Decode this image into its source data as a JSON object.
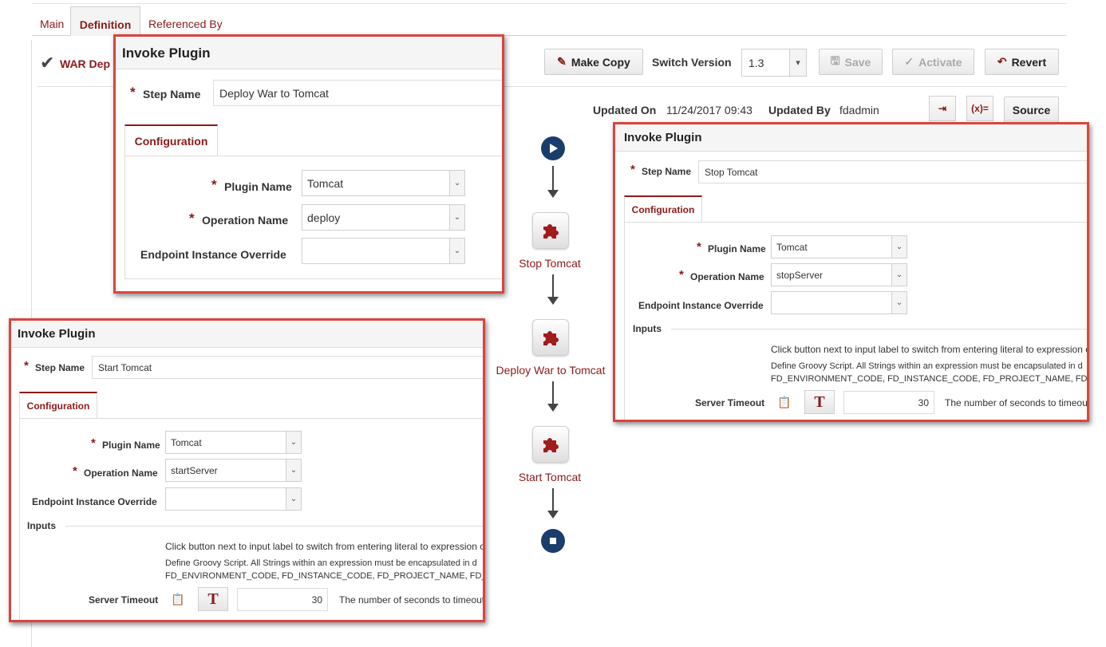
{
  "tabs": [
    {
      "label": "Main",
      "active": false
    },
    {
      "label": "Definition",
      "active": true
    },
    {
      "label": "Referenced By",
      "active": false
    }
  ],
  "header": {
    "title": "WAR Dep",
    "make_copy": "Make Copy",
    "switch_version_label": "Switch Version",
    "version": "1.3",
    "save": "Save",
    "activate": "Activate",
    "revert": "Revert",
    "updated_on_label": "Updated On",
    "updated_on": "11/24/2017 09:43",
    "updated_by_label": "Updated By",
    "updated_by": "fdadmin",
    "source": "Source",
    "expr_icon": "(x)="
  },
  "flow": {
    "steps": [
      {
        "label": "Stop Tomcat"
      },
      {
        "label": "Deploy War to Tomcat"
      },
      {
        "label": "Start Tomcat"
      }
    ]
  },
  "dialog_deploy": {
    "title": "Invoke Plugin",
    "step_name_label": "Step Name",
    "step_name": "Deploy War to Tomcat",
    "config_tab": "Configuration",
    "plugin_name_label": "Plugin Name",
    "plugin_name": "Tomcat",
    "operation_name_label": "Operation Name",
    "operation_name": "deploy",
    "endpoint_label": "Endpoint Instance Override",
    "endpoint": ""
  },
  "dialog_stop": {
    "title": "Invoke Plugin",
    "step_name_label": "Step Name",
    "step_name": "Stop Tomcat",
    "config_tab": "Configuration",
    "plugin_name_label": "Plugin Name",
    "plugin_name": "Tomcat",
    "operation_name_label": "Operation Name",
    "operation_name": "stopServer",
    "endpoint_label": "Endpoint Instance Override",
    "endpoint": "",
    "inputs_label": "Inputs",
    "help1": "Click button next to input label to switch from entering literal to expression or v",
    "help2": "Define Groovy Script. All Strings within an expression must be encapsulated in d",
    "help3": "FD_ENVIRONMENT_CODE, FD_INSTANCE_CODE, FD_PROJECT_NAME, FD_P",
    "timeout_label": "Server Timeout",
    "timeout_value": "30",
    "timeout_desc": "The number of seconds to timeout"
  },
  "dialog_start": {
    "title": "Invoke Plugin",
    "step_name_label": "Step Name",
    "step_name": "Start Tomcat",
    "config_tab": "Configuration",
    "plugin_name_label": "Plugin Name",
    "plugin_name": "Tomcat",
    "operation_name_label": "Operation Name",
    "operation_name": "startServer",
    "endpoint_label": "Endpoint Instance Override",
    "endpoint": "",
    "inputs_label": "Inputs",
    "help1": "Click button next to input label to switch from entering literal to expression or v",
    "help2": "Define Groovy Script. All Strings within an expression must be encapsulated in d",
    "help3": "FD_ENVIRONMENT_CODE, FD_INSTANCE_CODE, FD_PROJECT_NAME, FD_P",
    "timeout_label": "Server Timeout",
    "timeout_value": "30",
    "timeout_desc": "The number of seconds to timeout"
  },
  "colors": {
    "accent": "#8b1a1a",
    "highlight_border": "#d9453f",
    "flow_node": "#1b3d6d"
  }
}
